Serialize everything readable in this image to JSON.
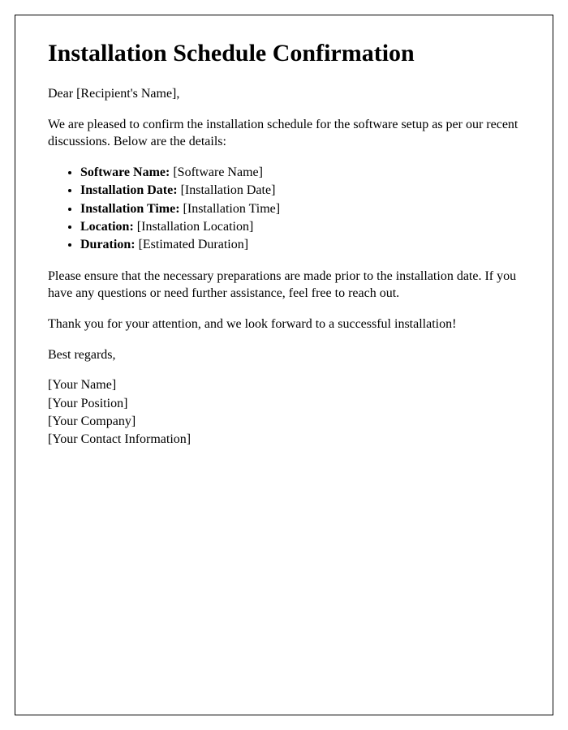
{
  "title": "Installation Schedule Confirmation",
  "greeting": "Dear [Recipient's Name],",
  "intro": "We are pleased to confirm the installation schedule for the software setup as per our recent discussions. Below are the details:",
  "details": [
    {
      "label": "Software Name:",
      "value": " [Software Name]"
    },
    {
      "label": "Installation Date:",
      "value": " [Installation Date]"
    },
    {
      "label": "Installation Time:",
      "value": " [Installation Time]"
    },
    {
      "label": "Location:",
      "value": " [Installation Location]"
    },
    {
      "label": "Duration:",
      "value": " [Estimated Duration]"
    }
  ],
  "instructions": "Please ensure that the necessary preparations are made prior to the installation date. If you have any questions or need further assistance, feel free to reach out.",
  "thanks": "Thank you for your attention, and we look forward to a successful installation!",
  "closing": "Best regards,",
  "signature": {
    "name": "[Your Name]",
    "position": "[Your Position]",
    "company": "[Your Company]",
    "contact": "[Your Contact Information]"
  }
}
